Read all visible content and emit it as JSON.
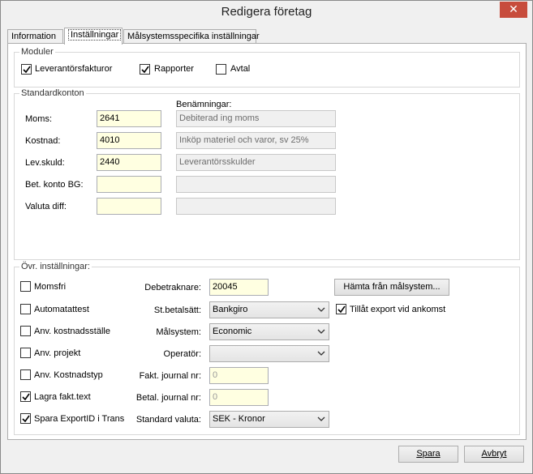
{
  "window": {
    "title": "Redigera företag",
    "close_glyph": "✕"
  },
  "tabs": [
    {
      "label": "Information"
    },
    {
      "label": "Inställningar"
    },
    {
      "label": "Målsystemsspecifika inställningar"
    }
  ],
  "modules": {
    "legend": "Moduler",
    "items": [
      {
        "label": "Leverantörsfakturor",
        "checked": true
      },
      {
        "label": "Rapporter",
        "checked": true
      },
      {
        "label": "Avtal",
        "checked": false
      }
    ]
  },
  "standard_accounts": {
    "legend": "Standardkonton",
    "names_header": "Benämningar:",
    "rows": [
      {
        "label": "Moms:",
        "value": "2641",
        "name": "Debiterad ing moms"
      },
      {
        "label": "Kostnad:",
        "value": "4010",
        "name": "Inköp materiel och varor, sv 25%"
      },
      {
        "label": "Lev.skuld:",
        "value": "2440",
        "name": "Leverantörsskulder"
      },
      {
        "label": "Bet. konto BG:",
        "value": "",
        "name": ""
      },
      {
        "label": "Valuta diff:",
        "value": "",
        "name": ""
      }
    ]
  },
  "other_settings": {
    "legend": "Övr. inställningar:",
    "checkboxes": [
      {
        "label": "Momsfri",
        "checked": false
      },
      {
        "label": "Automatattest",
        "checked": false
      },
      {
        "label": "Anv. kostnadsställe",
        "checked": false
      },
      {
        "label": "Anv. projekt",
        "checked": false
      },
      {
        "label": "Anv. Kostnadstyp",
        "checked": false
      },
      {
        "label": "Lagra fakt.text",
        "checked": true
      },
      {
        "label": "Spara ExportID i Trans",
        "checked": true
      }
    ],
    "debtor_label": "Debetraknare:",
    "debtor_value": "20045",
    "fetch_button": "Hämta från målsystem...",
    "payment_label": "St.betalsätt:",
    "payment_value": "Bankgiro",
    "allow_export_label": "Tillåt export vid ankomst",
    "allow_export_checked": true,
    "target_label": "Målsystem:",
    "target_value": "Economic",
    "operator_label": "Operatör:",
    "operator_value": "",
    "invoice_journal_label": "Fakt. journal nr:",
    "invoice_journal_value": "0",
    "pay_journal_label": "Betal. journal nr:",
    "pay_journal_value": "0",
    "currency_label": "Standard valuta:",
    "currency_value": "SEK - Kronor"
  },
  "footer": {
    "save_label": "Spara",
    "cancel_label": "Avbryt"
  }
}
